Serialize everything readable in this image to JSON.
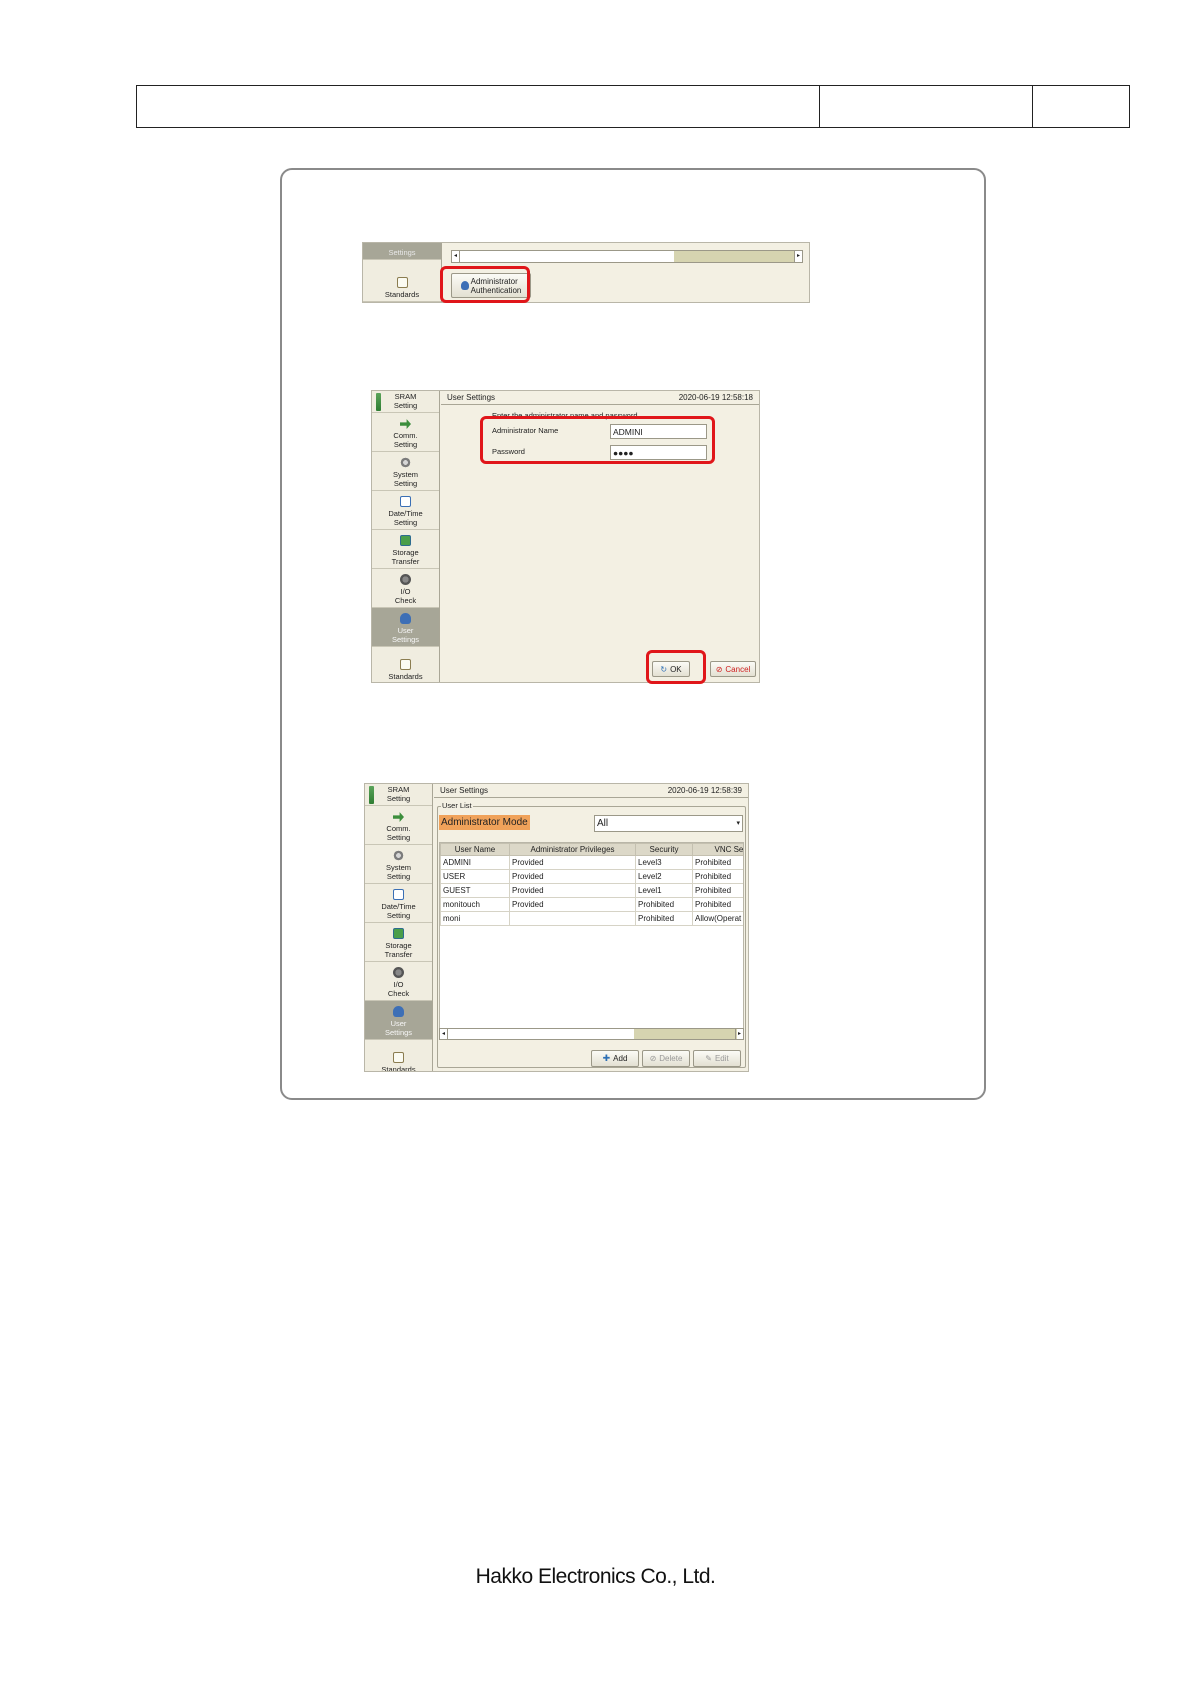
{
  "header": {
    "cells": [
      "",
      "",
      ""
    ]
  },
  "shot1": {
    "sidebar": [
      {
        "label": "Settings"
      },
      {
        "label": "Standards"
      }
    ],
    "admin_button": {
      "line1": "Administrator",
      "line2": "Authentication"
    }
  },
  "shot2": {
    "sidebar": [
      {
        "line1": "SRAM",
        "line2": "Setting",
        "icon": "sram-icon"
      },
      {
        "line1": "Comm.",
        "line2": "Setting",
        "icon": "comm-icon"
      },
      {
        "line1": "System",
        "line2": "Setting",
        "icon": "system-icon"
      },
      {
        "line1": "Date/Time",
        "line2": "Setting",
        "icon": "calendar-icon"
      },
      {
        "line1": "Storage",
        "line2": "Transfer",
        "icon": "storage-icon"
      },
      {
        "line1": "I/O",
        "line2": "Check",
        "icon": "io-icon"
      },
      {
        "line1": "User",
        "line2": "Settings",
        "icon": "user-icon"
      },
      {
        "line1": "",
        "line2": "Standards",
        "icon": "standards-icon"
      }
    ],
    "title": "User Settings",
    "datetime": "2020-06-19 12:58:18",
    "prompt": "Enter the administrator name and password.",
    "name_label": "Administrator Name",
    "name_value": "ADMINI",
    "password_label": "Password",
    "password_value": "●●●●",
    "ok_label": "OK",
    "cancel_label": "Cancel"
  },
  "shot3": {
    "sidebar": [
      {
        "line1": "SRAM",
        "line2": "Setting",
        "icon": "sram-icon"
      },
      {
        "line1": "Comm.",
        "line2": "Setting",
        "icon": "comm-icon"
      },
      {
        "line1": "System",
        "line2": "Setting",
        "icon": "system-icon"
      },
      {
        "line1": "Date/Time",
        "line2": "Setting",
        "icon": "calendar-icon"
      },
      {
        "line1": "Storage",
        "line2": "Transfer",
        "icon": "storage-icon"
      },
      {
        "line1": "I/O",
        "line2": "Check",
        "icon": "io-icon"
      },
      {
        "line1": "User",
        "line2": "Settings",
        "icon": "user-icon"
      },
      {
        "line1": "",
        "line2": "Standards",
        "icon": "standards-icon"
      }
    ],
    "title": "User Settings",
    "datetime": "2020-06-19 12:58:39",
    "group_label": "User List",
    "mode_label": "Administrator Mode",
    "filter_value": "All",
    "columns": [
      "User Name",
      "Administrator Privileges",
      "Security",
      "VNC Serve"
    ],
    "rows": [
      [
        "ADMINI",
        "Provided",
        "Level3",
        "Prohibited"
      ],
      [
        "USER",
        "Provided",
        "Level2",
        "Prohibited"
      ],
      [
        "GUEST",
        "Provided",
        "Level1",
        "Prohibited"
      ],
      [
        "monitouch",
        "Provided",
        "Prohibited",
        "Prohibited"
      ],
      [
        "moni",
        "",
        "Prohibited",
        "Allow(Operat"
      ]
    ],
    "add_label": "Add",
    "delete_label": "Delete",
    "edit_label": "Edit"
  },
  "footer": {
    "company": "Hakko Electronics Co., Ltd."
  },
  "colors": {
    "highlight_red": "#e0161a",
    "mode_orange": "#f0a25a",
    "panel_beige": "#f3f0e3"
  }
}
